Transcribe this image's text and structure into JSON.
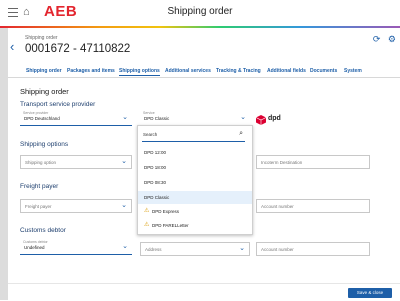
{
  "app": {
    "logo": "AEB",
    "title": "Shipping order"
  },
  "header": {
    "order_label": "Shipping order",
    "order_number": "0001672 - 47110822"
  },
  "tabs": [
    {
      "label": "Shipping order"
    },
    {
      "label": "Packages and items"
    },
    {
      "label": "Shipping options"
    },
    {
      "label": "Additional services"
    },
    {
      "label": "Tracking & Tracing"
    },
    {
      "label": "Additional fields"
    },
    {
      "label": "Documents"
    },
    {
      "label": "System"
    }
  ],
  "active_tab": "Shipping options",
  "form": {
    "section_title": "Shipping order",
    "transport": {
      "title": "Transport service provider",
      "provider_label": "Service provider",
      "provider_value": "DPD Deutschland",
      "service_label": "Service",
      "service_value": "DPD Classic",
      "brand_text": "dpd"
    },
    "shipping_options": {
      "title": "Shipping options",
      "shipping_option_placeholder": "Shipping option",
      "incoterm_placeholder": "Incoterm Destination"
    },
    "freight_payer": {
      "title": "Freight payer",
      "freight_payer_placeholder": "Freight payer",
      "account_placeholder": "Account number"
    },
    "customs_debtor": {
      "title": "Customs debtor",
      "debtor_label": "Customs debtor",
      "debtor_value": "Undefined",
      "address_placeholder": "Address",
      "account_placeholder": "Account number"
    }
  },
  "dropdown": {
    "search_placeholder": "Search",
    "items": [
      {
        "label": "DPD 12:00"
      },
      {
        "label": "DPD 18:00"
      },
      {
        "label": "DPD 08:30"
      },
      {
        "label": "DPD Classic"
      },
      {
        "label": "DPD Express"
      },
      {
        "label": "DPD PARELLetter"
      }
    ],
    "selected": "DPD Classic"
  },
  "footer": {
    "save_close_label": "Save & close"
  },
  "colors": {
    "brand": "#e3262f",
    "accent": "#1e5fa8",
    "selected_bg": "#e5f0fb",
    "warning": "#d99a00"
  }
}
